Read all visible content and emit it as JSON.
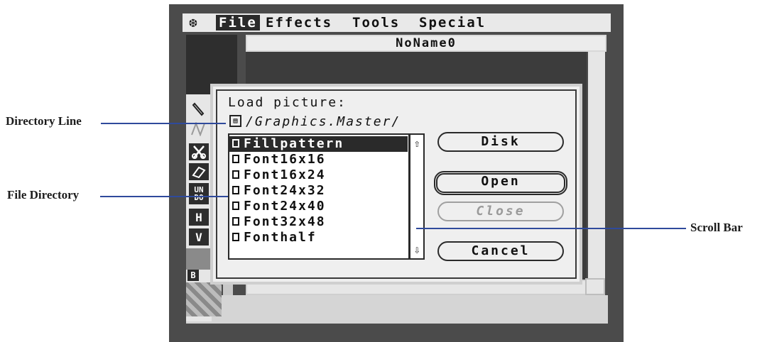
{
  "menu": {
    "apple": "❆",
    "items": [
      "File",
      "Effects",
      "Tools",
      "Special"
    ]
  },
  "document": {
    "title": "NoName0"
  },
  "toolbox": {
    "labels": [
      "UN\nDO",
      "H",
      "V",
      "B"
    ]
  },
  "dialog": {
    "title": "Load picture:",
    "directory": "/Graphics.Master/",
    "files": [
      "Fillpattern",
      "Font16x16",
      "Font16x24",
      "Font24x32",
      "Font24x40",
      "Font32x48",
      "Fonthalf"
    ],
    "selected_index": 0,
    "buttons": {
      "disk": "Disk",
      "open": "Open",
      "close": "Close",
      "cancel": "Cancel"
    }
  },
  "callouts": {
    "directory_line": "Directory Line",
    "file_directory": "File Directory",
    "scroll_bar": "Scroll Bar"
  },
  "colors": {
    "callout_line": "#2f4a9c",
    "screen_bg": "#4b4b4b"
  }
}
